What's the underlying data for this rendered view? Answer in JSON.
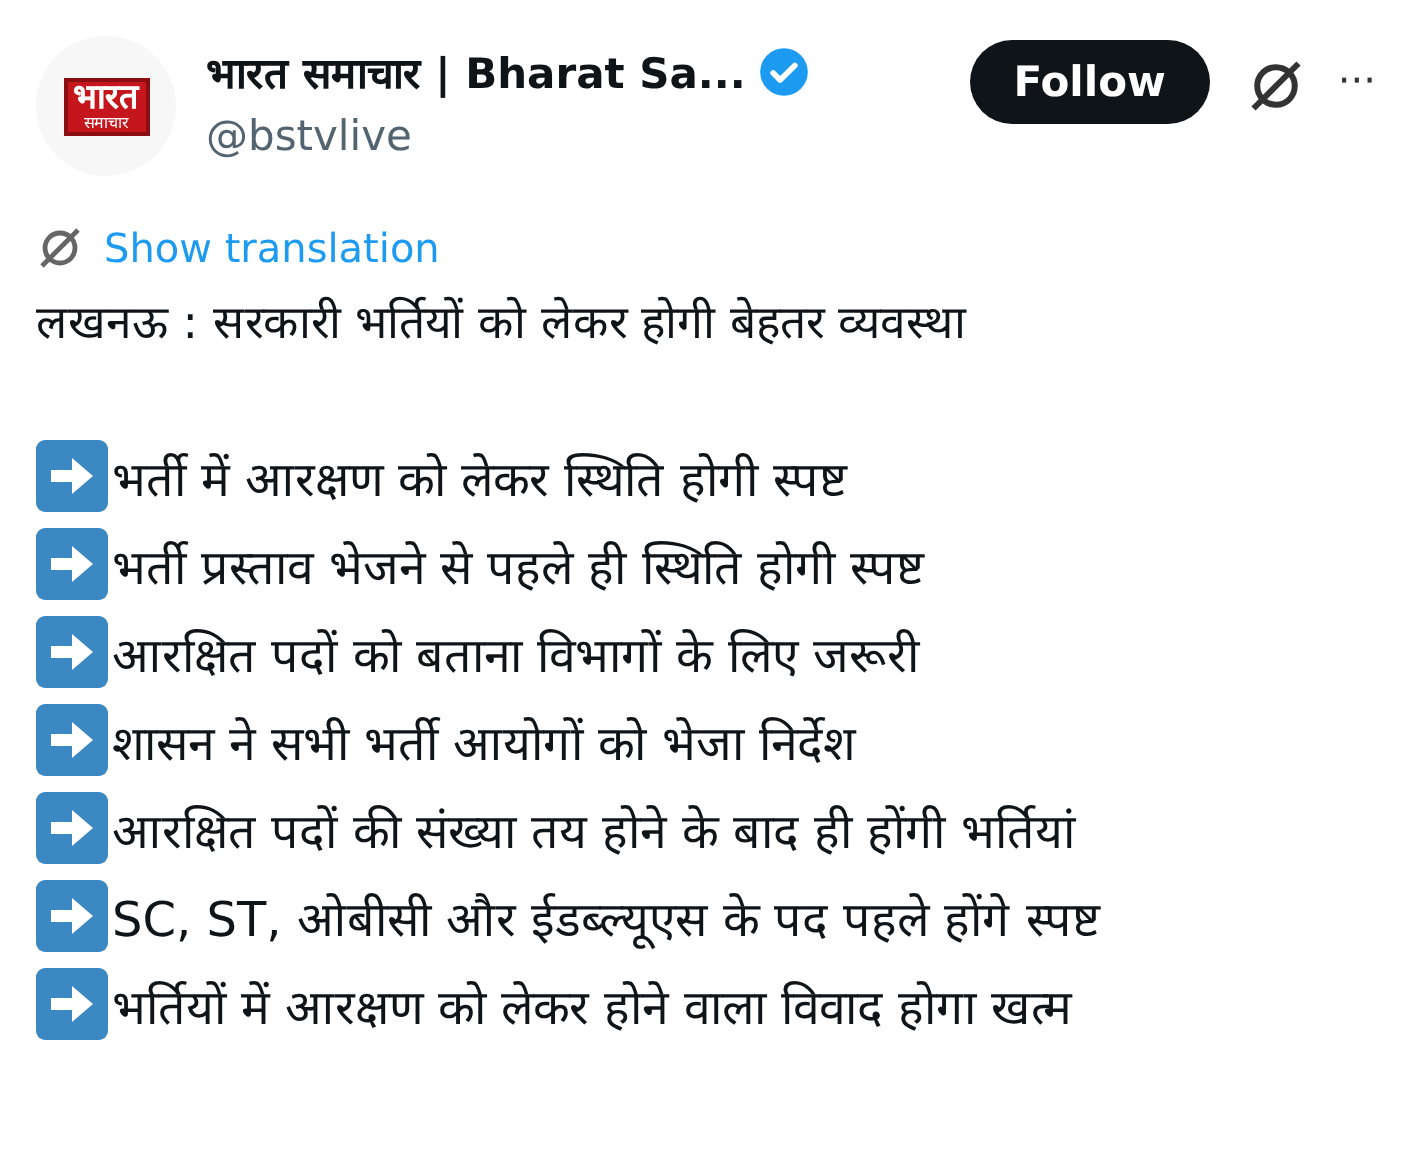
{
  "author": {
    "logo_text": "भारत",
    "logo_subtext": "समाचार",
    "name": "भारत समाचार | Bharat Sa...",
    "verified": true,
    "handle": "@bstvlive"
  },
  "follow_button": "Follow",
  "more_button": "···",
  "translation_link": "Show translation",
  "headline": "लखनऊ : सरकारी भर्तियों को लेकर होगी बेहतर व्यवस्था",
  "bullets": [
    {
      "text": "भर्ती में आरक्षण को लेकर स्थिति होगी स्पष्ट"
    },
    {
      "text": "भर्ती प्रस्ताव भेजने से पहले ही स्थिति होगी स्पष्ट"
    },
    {
      "text": "आरक्षित पदों को बताना विभागों के लिए जरूरी"
    },
    {
      "text": "शासन ने सभी भर्ती आयोगों को भेजा निर्देश"
    },
    {
      "text": "आरक्षित पदों की संख्या तय होने के बाद ही होंगी भर्तियां"
    },
    {
      "text": "SC, ST, ओबीसी और ईडब्ल्यूएस के पद पहले होंगे स्पष्ट"
    },
    {
      "text": "भर्तियों में आरक्षण को लेकर होने वाला विवाद होगा खत्म"
    }
  ]
}
